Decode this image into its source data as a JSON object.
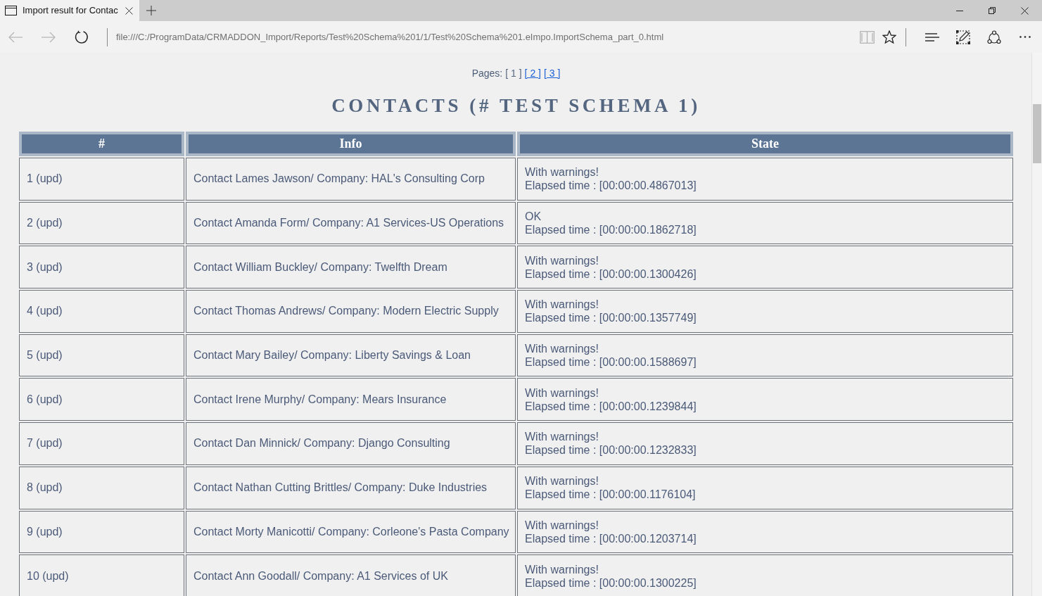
{
  "browser": {
    "tabs": [
      {
        "title": "Import result for Contac",
        "selected": true
      }
    ],
    "toolbar": {
      "back": {
        "disabled": true
      },
      "forward": {
        "disabled": true
      },
      "reading_view": {
        "disabled": true
      }
    },
    "address": "file:///C:/ProgramData/CRMADDON_Import/Reports/Test%20Schema%201/1/Test%20Schema%201.eImpo.ImportSchema_part_0.html"
  },
  "page": {
    "pagination": {
      "label": "Pages:",
      "pages": [
        {
          "label": "[ 1 ]",
          "selected": true
        },
        {
          "label": "[ 2 ]",
          "selected": false
        },
        {
          "label": "[ 3 ]",
          "selected": false
        }
      ]
    },
    "title": "CONTACTS (# TEST SCHEMA 1)",
    "table": {
      "columns": [
        "#",
        "Info",
        "State"
      ],
      "rows": [
        {
          "number": "1 (upd)",
          "info": "Contact Lames Jawson/ Company: HAL's Consulting Corp",
          "state": "With warnings!",
          "elapsed": "Elapsed time : [00:00:00.4867013]"
        },
        {
          "number": "2 (upd)",
          "info": "Contact Amanda Form/ Company: A1 Services-US Operations",
          "state": "OK",
          "elapsed": "Elapsed time : [00:00:00.1862718]"
        },
        {
          "number": "3 (upd)",
          "info": "Contact William Buckley/ Company: Twelfth Dream",
          "state": "With warnings!",
          "elapsed": "Elapsed time : [00:00:00.1300426]"
        },
        {
          "number": "4 (upd)",
          "info": "Contact Thomas Andrews/ Company: Modern Electric Supply",
          "state": "With warnings!",
          "elapsed": "Elapsed time : [00:00:00.1357749]"
        },
        {
          "number": "5 (upd)",
          "info": "Contact Mary Bailey/ Company: Liberty Savings & Loan",
          "state": "With warnings!",
          "elapsed": "Elapsed time : [00:00:00.1588697]"
        },
        {
          "number": "6 (upd)",
          "info": "Contact Irene Murphy/ Company: Mears Insurance",
          "state": "With warnings!",
          "elapsed": "Elapsed time : [00:00:00.1239844]"
        },
        {
          "number": "7 (upd)",
          "info": "Contact Dan Minnick/ Company: Django Consulting",
          "state": "With warnings!",
          "elapsed": "Elapsed time : [00:00:00.1232833]"
        },
        {
          "number": "8 (upd)",
          "info": "Contact Nathan Cutting Brittles/ Company: Duke Industries",
          "state": "With warnings!",
          "elapsed": "Elapsed time : [00:00:00.1176104]"
        },
        {
          "number": "9 (upd)",
          "info": "Contact Morty Manicotti/ Company: Corleone's Pasta Company",
          "state": "With warnings!",
          "elapsed": "Elapsed time : [00:00:00.1203714]"
        },
        {
          "number": "10 (upd)",
          "info": "Contact Ann Goodall/ Company: A1 Services of UK",
          "state": "With warnings!",
          "elapsed": "Elapsed time : [00:00:00.1300225]"
        }
      ]
    }
  }
}
